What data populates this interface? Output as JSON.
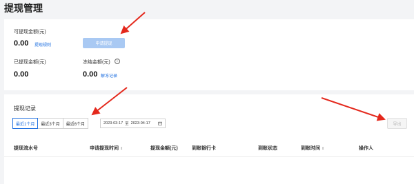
{
  "page": {
    "title": "提现管理"
  },
  "summary": {
    "available_label": "可提现金额(元)",
    "available_amount": "0.00",
    "rules_link": "提现规则",
    "apply_button": "申请提现",
    "withdrawn_label": "已提现金额(元)",
    "withdrawn_amount": "0.00",
    "frozen_label": "冻结金额(元)",
    "frozen_amount": "0.00",
    "frozen_info_icon": "info-icon",
    "unfreeze_link": "解冻记录"
  },
  "records": {
    "title": "提现记录",
    "periods": [
      {
        "label": "最近1个月",
        "active": true
      },
      {
        "label": "最近3个月",
        "active": false
      },
      {
        "label": "最近6个月",
        "active": false
      }
    ],
    "date_start": "2023-03-17",
    "date_sep": "至",
    "date_end": "2023-04-17",
    "export_button": "导出",
    "columns": [
      {
        "label": "提现流水号",
        "sortable": false
      },
      {
        "label": "申请提现时间",
        "sortable": true
      },
      {
        "label": "提现金额(元)",
        "sortable": false
      },
      {
        "label": "到账银行卡",
        "sortable": false
      },
      {
        "label": "到账状态",
        "sortable": false
      },
      {
        "label": "到账时间",
        "sortable": true
      },
      {
        "label": "操作人",
        "sortable": false
      }
    ]
  },
  "colors": {
    "accent": "#1e6fe0",
    "annotation_arrow": "#e4281c",
    "disabled_button": "#a9c9f3"
  }
}
